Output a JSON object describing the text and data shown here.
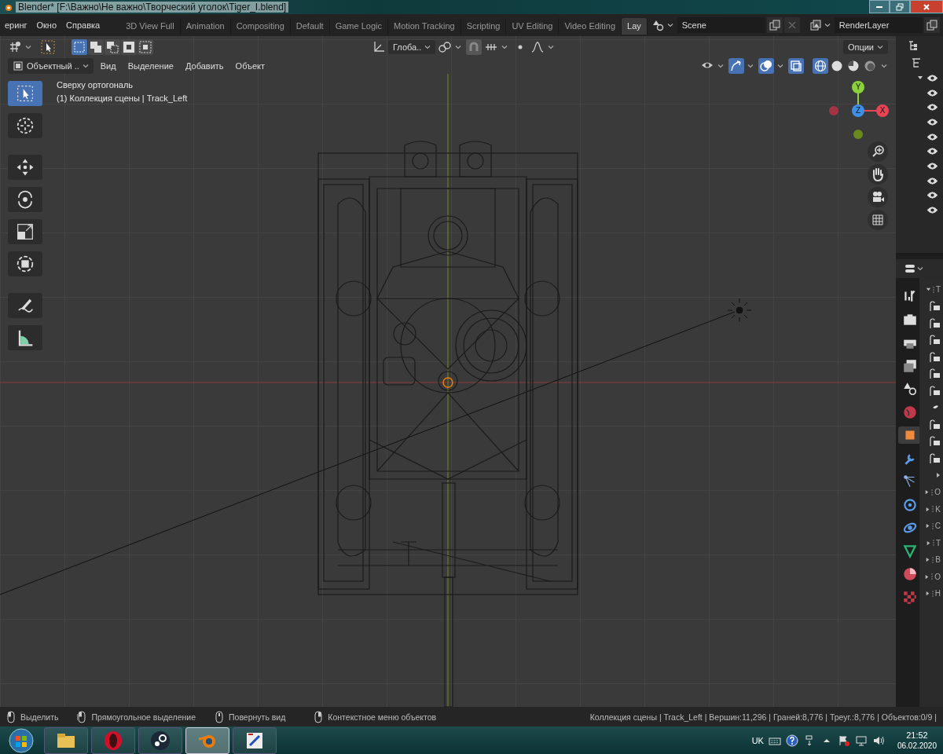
{
  "window": {
    "title": "Blender* [F:\\Важно\\Не важно\\Творческий уголок\\Tiger_I.blend]"
  },
  "menu": [
    "еринг",
    "Окно",
    "Справка"
  ],
  "workspaces": [
    {
      "label": "3D View Full",
      "selected": false
    },
    {
      "label": "Animation",
      "selected": false
    },
    {
      "label": "Compositing",
      "selected": false
    },
    {
      "label": "Default",
      "selected": false
    },
    {
      "label": "Game Logic",
      "selected": false
    },
    {
      "label": "Motion Tracking",
      "selected": false
    },
    {
      "label": "Scripting",
      "selected": false
    },
    {
      "label": "UV Editing",
      "selected": false
    },
    {
      "label": "Video Editing",
      "selected": false
    },
    {
      "label": "Lay",
      "selected": true
    }
  ],
  "scene": {
    "value": "Scene"
  },
  "view_layer": {
    "value": "RenderLayer"
  },
  "viewport_header": {
    "select_modes": [
      {
        "kind": "set",
        "selected": true
      },
      {
        "kind": "extend",
        "selected": false
      },
      {
        "kind": "subtract",
        "selected": false
      },
      {
        "kind": "difference",
        "selected": false
      },
      {
        "kind": "intersect",
        "selected": false
      }
    ],
    "orientation": "Глоба..",
    "snap_on": true,
    "options": "Опции",
    "mode": "Объектный ..",
    "menus": [
      "Вид",
      "Выделение",
      "Добавить",
      "Объект"
    ],
    "gizmos_on": true,
    "overlays_on": true,
    "xray_on": true,
    "shading": [
      {
        "kind": "wireframe",
        "selected": true
      },
      {
        "kind": "solid",
        "selected": false
      },
      {
        "kind": "material",
        "selected": false
      },
      {
        "kind": "rendered",
        "selected": false
      }
    ]
  },
  "tools": [
    {
      "kind": "select",
      "selected": true
    },
    {
      "kind": "cursor",
      "selected": false
    },
    {
      "kind": "move",
      "selected": false
    },
    {
      "kind": "rotate",
      "selected": false
    },
    {
      "kind": "scale",
      "selected": false
    },
    {
      "kind": "transform",
      "selected": false
    },
    {
      "kind": "annotate",
      "selected": false
    },
    {
      "kind": "measure",
      "selected": false
    }
  ],
  "overlay_text": [
    "Сверху ортогональ",
    "(1) Коллекция сцены | Track_Left"
  ],
  "gizmo": {
    "y": "Y",
    "z": "Z",
    "x": "X"
  },
  "outliner": {
    "rows": [
      {
        "expanded": true,
        "visible": true
      },
      {
        "visible": true
      },
      {
        "visible": true
      },
      {
        "visible": true
      },
      {
        "visible": true
      },
      {
        "visible": true
      },
      {
        "visible": true
      },
      {
        "visible": true
      },
      {
        "visible": true
      },
      {
        "visible": true
      }
    ]
  },
  "properties": {
    "tabs": [
      {
        "kind": "tool",
        "selected": false
      },
      {
        "kind": "render",
        "selected": false
      },
      {
        "kind": "output",
        "selected": false
      },
      {
        "kind": "view-layer",
        "selected": false
      },
      {
        "kind": "scene",
        "selected": false
      },
      {
        "kind": "world",
        "selected": false
      },
      {
        "kind": "object",
        "selected": true
      },
      {
        "kind": "modifiers",
        "selected": false
      },
      {
        "kind": "particles",
        "selected": false
      },
      {
        "kind": "physics",
        "selected": false
      },
      {
        "kind": "constraints",
        "selected": false
      },
      {
        "kind": "data",
        "selected": false
      },
      {
        "kind": "material",
        "selected": false
      },
      {
        "kind": "texture",
        "selected": false
      }
    ],
    "rows": [
      {
        "kind": "panel",
        "label": "T",
        "expanded": true
      },
      {
        "kind": "toggle"
      },
      {
        "kind": "toggle"
      },
      {
        "kind": "toggle"
      },
      {
        "kind": "toggle"
      },
      {
        "kind": "toggle"
      },
      {
        "kind": "toggle"
      },
      {
        "kind": "bullet"
      },
      {
        "kind": "toggle"
      },
      {
        "kind": "toggle"
      },
      {
        "kind": "toggle"
      },
      {
        "kind": "arrow"
      },
      {
        "kind": "panel",
        "label": "O",
        "expanded": false
      },
      {
        "kind": "panel",
        "label": "K",
        "expanded": false
      },
      {
        "kind": "panel",
        "label": "C",
        "expanded": false
      },
      {
        "kind": "panel",
        "label": "T",
        "expanded": false
      },
      {
        "kind": "panel",
        "label": "B",
        "expanded": false
      },
      {
        "kind": "panel",
        "label": "O",
        "expanded": false
      },
      {
        "kind": "panel",
        "label": "H",
        "expanded": false
      }
    ]
  },
  "status_bar": {
    "hints": [
      {
        "kind": "mouse-left",
        "text": "Выделить"
      },
      {
        "kind": "mouse-drag",
        "text": "Прямоугольное выделение"
      },
      {
        "kind": "mouse-middle",
        "text": "Повернуть вид"
      },
      {
        "kind": "mouse-right",
        "text": "Контекстное меню объектов"
      }
    ],
    "stats": "Коллекция сцены | Track_Left | Вершин:11,296 | Граней:8,776 | Треуг.:8,776 | Объектов:0/9 |"
  },
  "taskbar": {
    "apps": [
      {
        "kind": "folder",
        "selected": false
      },
      {
        "kind": "opera",
        "selected": false
      },
      {
        "kind": "steam",
        "selected": false
      },
      {
        "kind": "blender",
        "selected": true
      },
      {
        "kind": "paint",
        "selected": false
      }
    ],
    "language": "UK",
    "time": "21:52",
    "date": "06.02.2020"
  }
}
